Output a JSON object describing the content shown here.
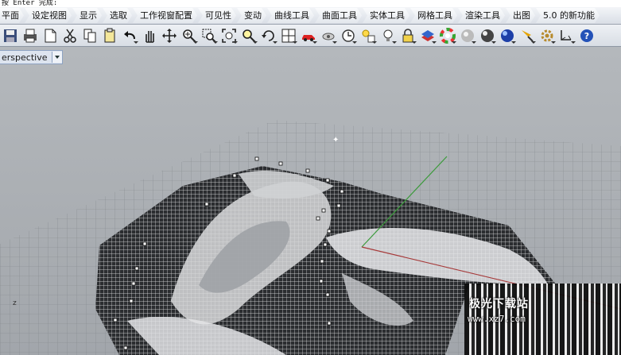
{
  "command_line": {
    "text": "按 Enter 完成:"
  },
  "tabs": [
    {
      "label": "平面"
    },
    {
      "label": "设定视图"
    },
    {
      "label": "显示"
    },
    {
      "label": "选取"
    },
    {
      "label": "工作视窗配置"
    },
    {
      "label": "可见性"
    },
    {
      "label": "变动"
    },
    {
      "label": "曲线工具"
    },
    {
      "label": "曲面工具"
    },
    {
      "label": "实体工具"
    },
    {
      "label": "网格工具"
    },
    {
      "label": "渲染工具"
    },
    {
      "label": "出图"
    },
    {
      "label": "5.0 的新功能"
    }
  ],
  "toolbar": {
    "icons": [
      "save-icon",
      "print-icon",
      "page-setup-icon",
      "cut-icon",
      "copy-icon",
      "paste-icon",
      "undo-icon",
      "pan-hand-icon",
      "rotate-view-icon",
      "zoom-icon",
      "zoom-window-icon",
      "zoom-extents-icon",
      "zoom-selected-icon",
      "rotate-camera-icon",
      "viewport-layout-icon",
      "car-icon",
      "camera-icon",
      "clock-icon",
      "light-icon",
      "bulb-icon",
      "lock-icon",
      "layer-icon",
      "color-wheel-icon",
      "sphere-shaded-icon",
      "sphere-render-icon",
      "blue-sphere-icon",
      "pencil-flag-icon",
      "gear-icon",
      "dimension-icon",
      "help-icon"
    ]
  },
  "viewport": {
    "label": "erspective",
    "axis_label": "z"
  },
  "watermark": {
    "title": "极光下载站",
    "url": "www.xz7.com"
  }
}
